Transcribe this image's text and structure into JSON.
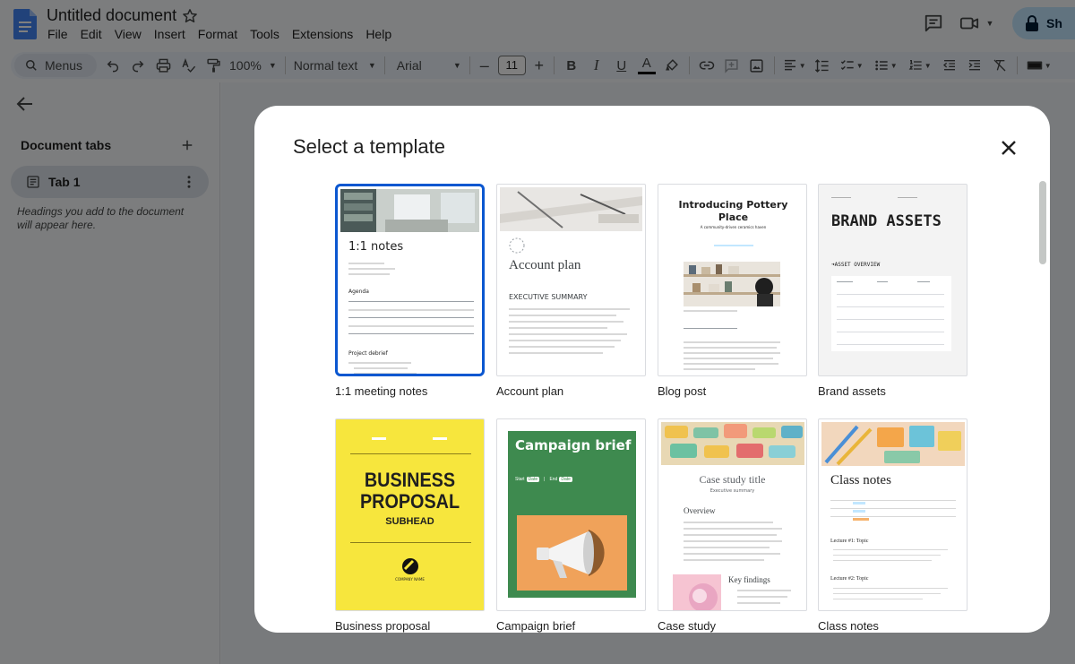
{
  "app": {
    "doc_title": "Untitled document",
    "menu": [
      "File",
      "Edit",
      "View",
      "Insert",
      "Format",
      "Tools",
      "Extensions",
      "Help"
    ],
    "share_label": "Sh"
  },
  "toolbar": {
    "menus_label": "Menus",
    "zoom": "100%",
    "style": "Normal text",
    "font": "Arial",
    "font_size": "11",
    "bold": "B",
    "italic": "I",
    "underline": "U",
    "text_color_letter": "A"
  },
  "sidebar": {
    "tabs_heading": "Document tabs",
    "tab_label": "Tab 1",
    "hint": "Headings you add to the document will appear here."
  },
  "dialog": {
    "title": "Select a template",
    "templates": [
      {
        "label": "1:1 meeting notes",
        "thumb_title": "1:1 notes",
        "thumb_sub1": "Agenda",
        "thumb_sub2": "Project debrief"
      },
      {
        "label": "Account plan",
        "thumb_title": "Account plan",
        "thumb_sub1": "EXECUTIVE SUMMARY"
      },
      {
        "label": "Blog post",
        "thumb_title": "Introducing Pottery Place",
        "thumb_sub1": "A community-driven ceramics haven"
      },
      {
        "label": "Brand assets",
        "thumb_title": "BRAND ASSETS",
        "thumb_sub1": "➜ASSET OVERVIEW"
      },
      {
        "label": "Business proposal",
        "thumb_title": "BUSINESS PROPOSAL",
        "thumb_sub1": "SUBHEAD",
        "thumb_sub2": "COMPANY NAME"
      },
      {
        "label": "Campaign brief",
        "thumb_title": "Campaign brief",
        "thumb_sub1": "Start",
        "thumb_sub2": "End",
        "thumb_date": "Date"
      },
      {
        "label": "Case study",
        "thumb_title": "Case study title",
        "thumb_sub1": "Executive summary",
        "thumb_sub2": "Overview",
        "thumb_sub3": "Key findings"
      },
      {
        "label": "Class notes",
        "thumb_title": "Class notes",
        "thumb_sub1": "Lecture #1: Topic",
        "thumb_sub2": "Lecture #2: Topic"
      }
    ]
  },
  "colors": {
    "accent_blue": "#0b57d0",
    "doc_blue": "#4285f4",
    "proposal_yellow": "#f7e63d",
    "campaign_green": "#3e8a4f",
    "campaign_orange": "#f0a25a",
    "share_bg": "#c2e7ff"
  }
}
